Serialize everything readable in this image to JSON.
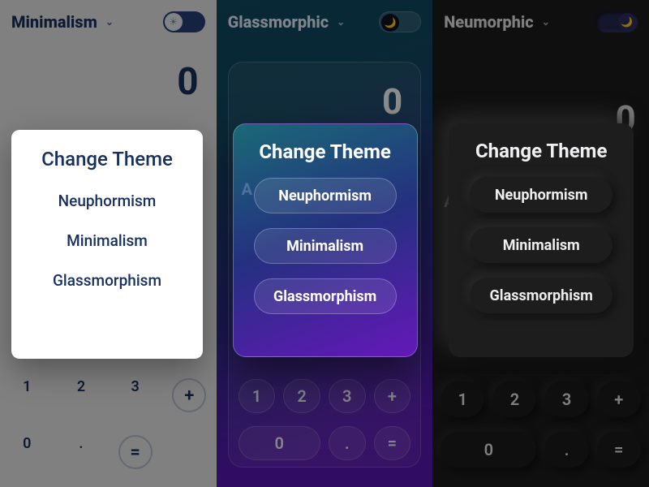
{
  "panels": {
    "minimal": {
      "name": "Minimalism",
      "display": "0",
      "row1": {
        "c1": "1",
        "c2": "2",
        "c3": "3",
        "op": "+"
      },
      "row2": {
        "c1": "0",
        "c2": ".",
        "op": "="
      },
      "modal": {
        "title": "Change Theme",
        "opt1": "Neuphormism",
        "opt2": "Minimalism",
        "opt3": "Glassmorphism"
      },
      "toggle_icon": "☀"
    },
    "glass": {
      "name": "Glassmorphic",
      "display": "0",
      "sub": "A",
      "row1": {
        "c1": "1",
        "c2": "2",
        "c3": "3",
        "op": "+"
      },
      "row2": {
        "zero": "0",
        "dot": ".",
        "eq": "="
      },
      "modal": {
        "title": "Change Theme",
        "opt1": "Neuphormism",
        "opt2": "Minimalism",
        "opt3": "Glassmorphism"
      },
      "toggle_icon": "🌙"
    },
    "neu": {
      "name": "Neumorphic",
      "display": "0",
      "sub": "A",
      "row1": {
        "c1": "1",
        "c2": "2",
        "c3": "3",
        "op": "+"
      },
      "row2": {
        "zero": "0",
        "dot": ".",
        "eq": "="
      },
      "modal": {
        "title": "Change Theme",
        "opt1": "Neuphormism",
        "opt2": "Minimalism",
        "opt3": "Glassmorphism"
      },
      "toggle_icon": "🌙"
    }
  },
  "colors": {
    "minimal_accent": "#17305f",
    "glass_grad_start": "#0f4b62",
    "glass_grad_end": "#5a17b5",
    "neu_bg": "#1d1d1d"
  }
}
